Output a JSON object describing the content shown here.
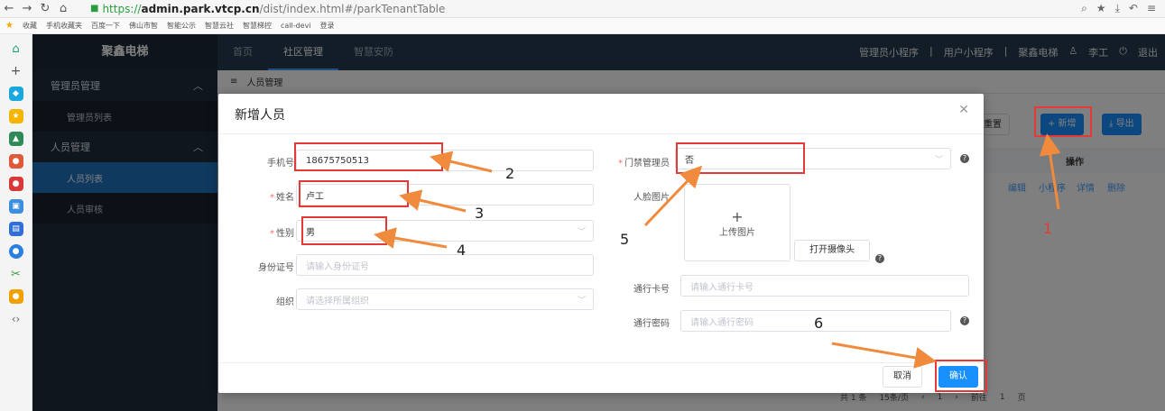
{
  "browser": {
    "url_proto": "https://",
    "url_host": "admin.park.vtcp.cn",
    "url_path": "/dist/index.html#/parkTenantTable",
    "bookmarks": [
      "收藏",
      "手机收藏夹",
      "百度一下",
      "佛山市智",
      "智能公示",
      "智慧云社",
      "智慧梯控",
      "call-devi",
      "登录"
    ]
  },
  "sidebar": {
    "logo": "聚鑫电梯",
    "groups": [
      {
        "label": "管理员管理",
        "items": [
          {
            "label": "管理员列表"
          }
        ]
      },
      {
        "label": "人员管理",
        "items": [
          {
            "label": "人员列表"
          },
          {
            "label": "人员审核"
          }
        ]
      }
    ]
  },
  "header": {
    "tabs": [
      "首页",
      "社区管理",
      "智慧安防"
    ],
    "right": [
      "管理员小程序",
      "|",
      "用户小程序",
      "|",
      "聚鑫电梯",
      "李工",
      "退出"
    ]
  },
  "breadcrumb": "人员管理",
  "background": {
    "reset": "重置",
    "add": "+ 新增",
    "export": "导出",
    "ops_header": "操作",
    "ops": [
      "编辑",
      "小程序",
      "详情",
      "删除"
    ],
    "pager": {
      "total": "共 1 条",
      "size": "15条/页",
      "page": "1",
      "goto": "前往",
      "goto_val": "1",
      "unit": "页"
    }
  },
  "dialog": {
    "title": "新增人员",
    "phone_label": "手机号",
    "phone_value": "18675750513",
    "name_label": "姓名",
    "name_value": "卢工",
    "gender_label": "性别",
    "gender_value": "男",
    "idcard_label": "身份证号",
    "idcard_placeholder": "请输入身份证号",
    "org_label": "组织",
    "org_placeholder": "请选择所属组织",
    "door_admin_label": "门禁管理员",
    "door_admin_value": "否",
    "face_label": "人脸图片",
    "upload_text": "上传图片",
    "camera_label": "打开摄像头",
    "card_label": "通行卡号",
    "card_placeholder": "请输入通行卡号",
    "pwd_label": "通行密码",
    "pwd_placeholder": "请输入通行密码",
    "cancel": "取消",
    "confirm": "确认"
  },
  "annotations": [
    "1",
    "2",
    "3",
    "4",
    "5",
    "6"
  ],
  "colors": {
    "annotation": "#e53935",
    "arrow": "#f08a3c",
    "primary": "#1890ff",
    "sidebar": "#1f2d3d"
  }
}
